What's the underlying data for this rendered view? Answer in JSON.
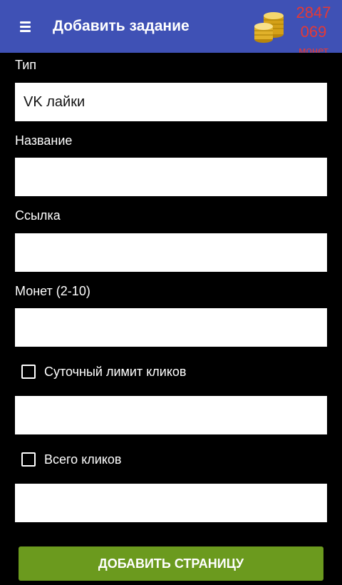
{
  "appbar": {
    "title": "Добавить задание",
    "menu_icon": "hamburger-menu-icon",
    "coins_icon": "coin-stack-icon",
    "coin_balance": "2847\n069",
    "coin_unit": "монет"
  },
  "form": {
    "type": {
      "label": "Тип",
      "value": "VK лайки"
    },
    "name": {
      "label": "Название",
      "value": ""
    },
    "link": {
      "label": "Ссылка",
      "value": ""
    },
    "coins": {
      "label": "Монет (2-10)",
      "value": ""
    },
    "daily_limit": {
      "label": "Суточный лимит кликов",
      "checked": false,
      "value": ""
    },
    "total_clicks": {
      "label": "Всего кликов",
      "checked": false,
      "value": ""
    }
  },
  "submit": {
    "label": "ДОБАВИТЬ СТРАНИЦУ"
  },
  "colors": {
    "appbar": "#3F51B5",
    "background": "#000000",
    "balance": "#E53935",
    "button": "#6B9A1E"
  }
}
